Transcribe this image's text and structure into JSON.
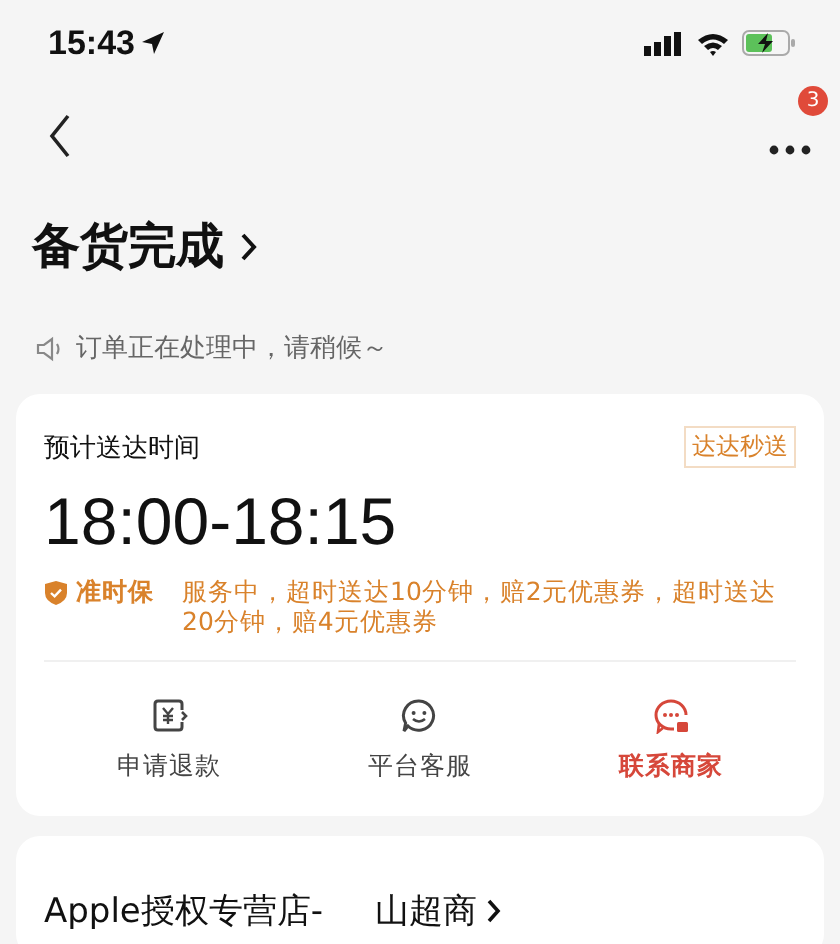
{
  "status_bar": {
    "time": "15:43"
  },
  "nav": {
    "badge": "3"
  },
  "title": "备货完成",
  "notice": "订单正在处理中，请稍候～",
  "delivery": {
    "label": "预计送达时间",
    "tag": "达达秒送",
    "time": "18:00-18:15",
    "guarantee_label": "准时保",
    "guarantee_text": "服务中，超时送达10分钟，赔2元优惠券，超时送达20分钟，赔4元优惠券"
  },
  "actions": [
    {
      "kind": "refund",
      "label": "申请退款",
      "highlighted": false
    },
    {
      "kind": "service",
      "label": "平台客服",
      "highlighted": false
    },
    {
      "kind": "merchant",
      "label": "联系商家",
      "highlighted": true
    }
  ],
  "store": {
    "name_start": "Apple授权专营店-",
    "name_end": "山超商"
  }
}
